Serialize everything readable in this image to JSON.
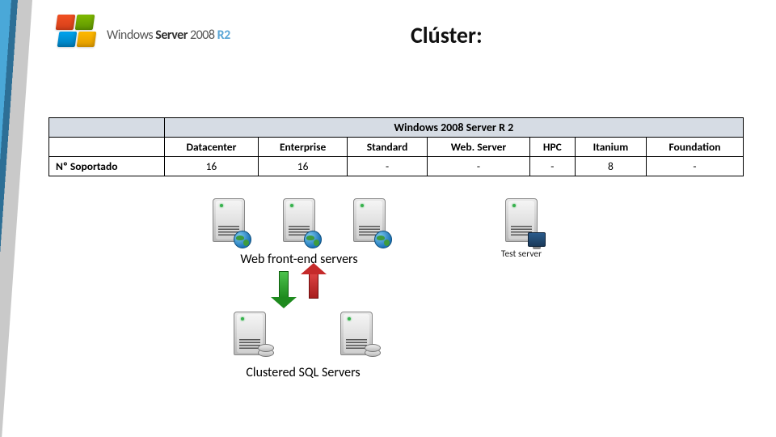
{
  "logo": {
    "brand": "Windows",
    "product": "Server",
    "year": "2008",
    "suffix": "R2"
  },
  "title": "Clúster:",
  "table": {
    "super_header": "Windows 2008 Server R 2",
    "columns": [
      "Datacenter",
      "Enterprise",
      "Standard",
      "Web. Server",
      "HPC",
      "Itanium",
      "Foundation"
    ],
    "row_label": "Nº Soportado",
    "values": [
      "16",
      "16",
      "-",
      "-",
      "-",
      "8",
      "-"
    ]
  },
  "diagram": {
    "frontend_label": "Web front-end servers",
    "test_label": "Test server",
    "cluster_label": "Clustered SQL Servers"
  },
  "chart_data": {
    "type": "table",
    "title": "Nº Soportado — Windows 2008 Server R2",
    "categories": [
      "Datacenter",
      "Enterprise",
      "Standard",
      "Web.Server",
      "HPC",
      "Itanium",
      "Foundation"
    ],
    "values": [
      16,
      16,
      null,
      null,
      null,
      8,
      null
    ]
  }
}
